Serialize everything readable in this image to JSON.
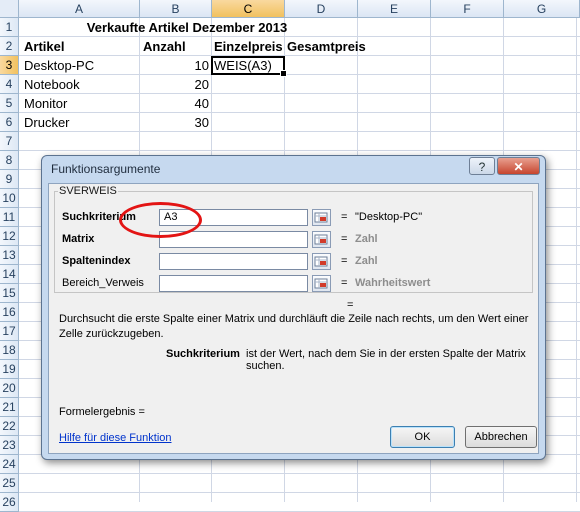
{
  "sheet": {
    "columns": [
      "A",
      "B",
      "C",
      "D",
      "E",
      "F",
      "G"
    ],
    "rows": [
      "1",
      "2",
      "3",
      "4",
      "5",
      "6",
      "7",
      "8",
      "9",
      "10",
      "11",
      "12",
      "13",
      "14",
      "15",
      "16",
      "17",
      "18",
      "19",
      "20",
      "21",
      "22",
      "23",
      "24",
      "25",
      "26"
    ],
    "selected_column": "C",
    "selected_row": "3",
    "title": "Verkaufte Artikel Dezember 2013",
    "headers": {
      "artikel": "Artikel",
      "anzahl": "Anzahl",
      "einzelpreis": "Einzelpreis",
      "gesamtpreis": "Gesamtpreis"
    },
    "data": [
      {
        "artikel": "Desktop-PC",
        "anzahl": "10"
      },
      {
        "artikel": "Notebook",
        "anzahl": "20"
      },
      {
        "artikel": "Monitor",
        "anzahl": "40"
      },
      {
        "artikel": "Drucker",
        "anzahl": "30"
      }
    ],
    "active_cell_value": "WEIS(A3)"
  },
  "dialog": {
    "title": "Funktionsargumente",
    "help_button": "?",
    "function_name": "SVERWEIS",
    "args": [
      {
        "label": "Suchkriterium",
        "value": "A3",
        "result": "\"Desktop-PC\"",
        "type": "result"
      },
      {
        "label": "Matrix",
        "value": "",
        "result": "Zahl",
        "type": "hint"
      },
      {
        "label": "Spaltenindex",
        "value": "",
        "result": "Zahl",
        "type": "hint"
      },
      {
        "label": "Bereich_Verweis",
        "value": "",
        "result": "Wahrheitswert",
        "type": "hint"
      }
    ],
    "equals": "=",
    "description": "Durchsucht die erste Spalte einer Matrix und durchläuft die Zeile nach rechts, um den Wert einer Zelle zurückzugeben.",
    "current_arg_name": "Suchkriterium",
    "current_arg_desc": "ist der Wert, nach dem Sie in der ersten Spalte der Matrix suchen.",
    "formula_result": "Formelergebnis =",
    "help_link": "Hilfe für diese Funktion",
    "ok_label": "OK",
    "cancel_label": "Abbrechen"
  },
  "colors": {
    "highlight_circle": "#e31414",
    "link": "#0033cc"
  }
}
